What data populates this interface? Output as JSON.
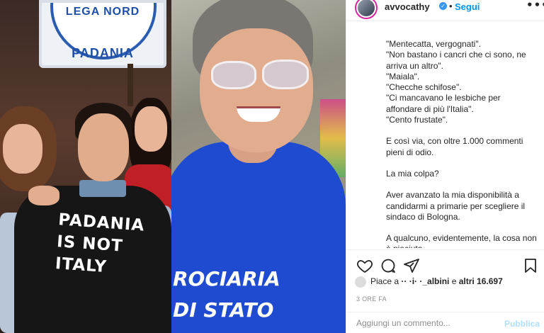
{
  "photo": {
    "sign_top_text": "LEGA NORD",
    "sign_text": "PADANIA",
    "shirt_lines": [
      "PADANIA",
      "IS NOT",
      "ITALY"
    ],
    "woman_shirt_lines": [
      "ROCIARIA",
      "DI STATO"
    ]
  },
  "header": {
    "username": "avvocathy",
    "verified_mark": "✓",
    "separator": "•",
    "follow_label": "Segui",
    "more_icon": "•••"
  },
  "caption": {
    "lines": [
      "\"Mentecatta, vergognati\".",
      "\"Non bastano i cancri che ci sono, ne arriva un altro\".",
      "\"Maiala\".",
      "\"Checche schifose\".",
      "\"Ci mancavano le lesbiche per affondare di più l'Italia\".",
      "\"Cento frustate\"."
    ],
    "para2": "E così via, con oltre 1.000 commenti pieni di odio.",
    "para3": "La mia colpa?",
    "para4": "Aver avanzato la mia disponibilità a candidarmi a primarie per scegliere il sindaco di Bologna.",
    "para5": "A qualcuno, evidentemente, la cosa non è piaciuta."
  },
  "actions": {
    "icons": [
      "heart-icon",
      "comment-icon",
      "share-icon",
      "bookmark-icon"
    ]
  },
  "likes": {
    "prefix": "Piace a",
    "name": "·· ·i· ·_albini",
    "middle": " e ",
    "others": "altri 16.697"
  },
  "time": "3 ORE FA",
  "comment": {
    "placeholder": "Aggiungi un commento...",
    "publish_label": "Pubblica"
  }
}
